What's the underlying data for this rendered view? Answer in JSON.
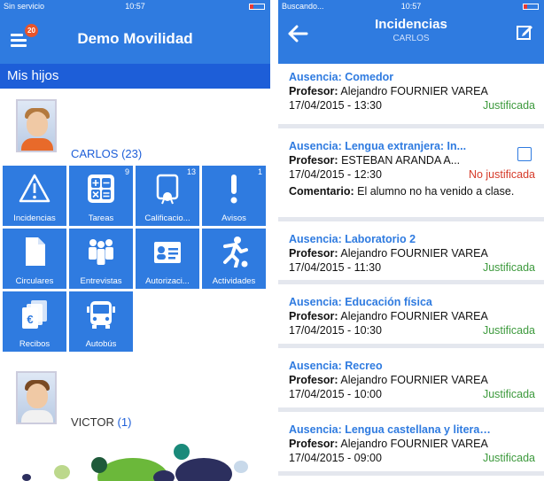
{
  "left": {
    "status": {
      "carrier": "Sin servicio",
      "time": "10:57"
    },
    "nav": {
      "title": "Demo Movilidad",
      "menu_badge": "20"
    },
    "section": "Mis hijos",
    "children": [
      {
        "name": "CARLOS",
        "count": "(23)"
      },
      {
        "name": "VICTOR",
        "count": "(1)"
      }
    ],
    "tiles": [
      {
        "label": "Incidencias",
        "count": "",
        "icon": "warning-icon"
      },
      {
        "label": "Tareas",
        "count": "9",
        "icon": "calculator-icon"
      },
      {
        "label": "Calificacio...",
        "count": "13",
        "icon": "grades-icon"
      },
      {
        "label": "Avisos",
        "count": "1",
        "icon": "exclamation-icon"
      },
      {
        "label": "Circulares",
        "count": "",
        "icon": "document-icon"
      },
      {
        "label": "Entrevistas",
        "count": "",
        "icon": "meeting-icon"
      },
      {
        "label": "Autorizaci...",
        "count": "",
        "icon": "id-card-icon"
      },
      {
        "label": "Actividades",
        "count": "",
        "icon": "sport-icon"
      },
      {
        "label": "Recibos",
        "count": "",
        "icon": "receipts-icon"
      },
      {
        "label": "Autobús",
        "count": "",
        "icon": "bus-icon"
      }
    ]
  },
  "right": {
    "status": {
      "carrier": "Buscando...",
      "time": "10:57"
    },
    "nav": {
      "title": "Incidencias",
      "subtitle": "CARLOS"
    },
    "labels": {
      "profesor": "Profesor:",
      "comentario": "Comentario:"
    },
    "items": [
      {
        "title": "Ausencia: Comedor",
        "teacher": "Alejandro FOURNIER VAREA",
        "date": "17/04/2015 - 13:30",
        "state": "Justificada",
        "justified": true,
        "comment": ""
      },
      {
        "title": "Ausencia: Lengua extranjera: In...",
        "teacher": "ESTEBAN ARANDA A...",
        "date": "17/04/2015 - 12:30",
        "state": "No justificada",
        "justified": false,
        "comment": "El alumno no ha venido a clase."
      },
      {
        "title": "Ausencia: Laboratorio 2",
        "teacher": "Alejandro FOURNIER VAREA",
        "date": "17/04/2015 - 11:30",
        "state": "Justificada",
        "justified": true,
        "comment": ""
      },
      {
        "title": "Ausencia: Educación física",
        "teacher": "Alejandro FOURNIER VAREA",
        "date": "17/04/2015 - 10:30",
        "state": "Justificada",
        "justified": true,
        "comment": ""
      },
      {
        "title": "Ausencia: Recreo",
        "teacher": "Alejandro FOURNIER VAREA",
        "date": "17/04/2015 - 10:00",
        "state": "Justificada",
        "justified": true,
        "comment": ""
      },
      {
        "title": "Ausencia: Lengua castellana y literatura",
        "teacher": "Alejandro FOURNIER VAREA",
        "date": "17/04/2015 - 09:00",
        "state": "Justificada",
        "justified": true,
        "comment": ""
      }
    ]
  },
  "colors": {
    "primary": "#2f7be0",
    "section": "#1d5ed8",
    "justified": "#3d9a3d",
    "unjustified": "#d63b2a",
    "badge": "#e8542a"
  }
}
